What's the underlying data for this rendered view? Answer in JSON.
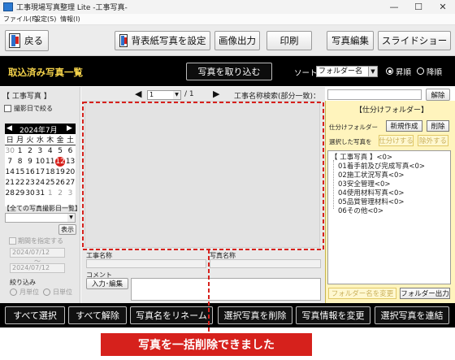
{
  "window": {
    "title": "工事現場写真整理 Lite -工事写真-",
    "minimize": "—",
    "maximize": "☐",
    "close": "✕"
  },
  "menu": [
    "ファイル(F)",
    "設定(S)",
    "情報(I)"
  ],
  "toolbar": {
    "back": "戻る",
    "set_wallpaper": "背表紙写真を設定",
    "image_output": "画像出力",
    "print": "印刷",
    "photo_edit": "写真編集",
    "slideshow": "スライドショー"
  },
  "header": {
    "section_title": "取込済み写真一覧",
    "import_button": "写真を取り込む",
    "sort_label": "ソート",
    "sort_value": "フォルダー名",
    "ascending": "昇順",
    "descending": "降順"
  },
  "left": {
    "group_title": "【 工事写真 】",
    "filter_by_date": "撮影日で絞る",
    "calendar": {
      "month": "2024年7月",
      "weekdays": [
        "日",
        "月",
        "火",
        "水",
        "木",
        "金",
        "土"
      ],
      "days": [
        "30",
        "1",
        "2",
        "3",
        "4",
        "5",
        "6",
        "7",
        "8",
        "9",
        "10",
        "11",
        "12",
        "13",
        "14",
        "15",
        "16",
        "17",
        "18",
        "19",
        "20",
        "21",
        "22",
        "23",
        "24",
        "25",
        "26",
        "27",
        "28",
        "29",
        "30",
        "31",
        "1",
        "2",
        "3"
      ],
      "highlighted": "12"
    },
    "all_dates_label": "【全ての写真撮影日一覧】",
    "show_button": "表示",
    "period_label": "期間を指定する",
    "date_from": "2024/07/12",
    "date_sep": "〜",
    "date_to": "2024/07/12",
    "narrow_label": "絞り込み",
    "by_month": "月単位",
    "by_day": "日単位"
  },
  "center": {
    "page_current": "1",
    "page_total": "/ 1",
    "search_label": "工事名称検索(部分一致)：",
    "clear_button": "解除",
    "project_name_label": "工事名称",
    "photo_name_label": "写真名称",
    "comment_label": "コメント",
    "input_edit_button": "入力･編集"
  },
  "right": {
    "panel_title": "【仕分けフォルダー】",
    "folder_label": "仕分けフォルダー",
    "new_button": "新規作成",
    "delete_button": "削除",
    "selected_label": "選択した写真を",
    "sort_button": "仕分けする",
    "remove_button": "除外する",
    "tree": [
      "【 工事写真 】<0>",
      "01着手前及び完成写真<0>",
      "02施工状況写真<0>",
      "03安全管理<0>",
      "04使用材料写真<0>",
      "05品質管理材料<0>",
      "06その他<0>"
    ],
    "rename_folder": "フォルダー名を変更",
    "output_folder": "フォルダー出力"
  },
  "bottom": {
    "select_all": "すべて選択",
    "deselect_all": "すべて解除",
    "rename_photos": "写真名をリネーム",
    "delete_selected": "選択写真を削除",
    "change_info": "写真情報を変更",
    "link_selected": "選択写真を連結"
  },
  "callout": "写真を一括削除できました",
  "colors": {
    "accent_yellow": "#f4d24a",
    "callout_red": "#d6211c",
    "panel_yellow": "#fff4bd"
  }
}
